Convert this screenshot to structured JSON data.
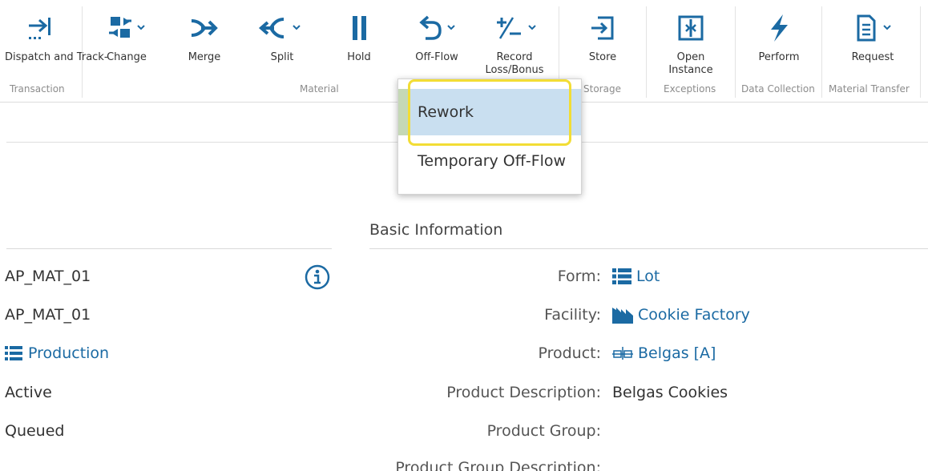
{
  "ribbon": {
    "buttons": [
      {
        "id": "dispatch",
        "label": "Dispatch and Track-",
        "icon": "dispatch-arrow-icon",
        "dropdown": false
      },
      {
        "id": "change",
        "label": "Change",
        "icon": "change-swap-icon",
        "dropdown": true
      },
      {
        "id": "merge",
        "label": "Merge",
        "icon": "merge-icon",
        "dropdown": false
      },
      {
        "id": "split",
        "label": "Split",
        "icon": "split-icon",
        "dropdown": true
      },
      {
        "id": "hold",
        "label": "Hold",
        "icon": "pause-icon",
        "dropdown": false
      },
      {
        "id": "offflow",
        "label": "Off-Flow",
        "icon": "undo-arrow-icon",
        "dropdown": true
      },
      {
        "id": "record",
        "label": "Record Loss/Bonus",
        "icon": "plus-minus-icon",
        "dropdown": true
      },
      {
        "id": "store",
        "label": "Store",
        "icon": "store-enter-icon",
        "dropdown": false
      },
      {
        "id": "open_instance",
        "label": "Open Instance",
        "icon": "open-instance-icon",
        "dropdown": false
      },
      {
        "id": "perform",
        "label": "Perform",
        "icon": "lightning-icon",
        "dropdown": false
      },
      {
        "id": "request",
        "label": "Request",
        "icon": "document-icon",
        "dropdown": true
      }
    ],
    "groups": {
      "transaction": "Transaction",
      "material": "Material",
      "storage": "Storage",
      "exceptions": "Exceptions",
      "data_collection": "Data Collection",
      "material_transfer": "Material Transfer"
    }
  },
  "dropdown": {
    "items": [
      "Rework",
      "Temporary Off-Flow"
    ]
  },
  "left_values": {
    "name": "AP_MAT_01",
    "name2": "AP_MAT_01",
    "type": "Production",
    "status": "Active",
    "state": "Queued"
  },
  "basic_info": {
    "title": "Basic Information",
    "form_label": "Form:",
    "form_value": "Lot",
    "facility_label": "Facility:",
    "facility_value": "Cookie Factory",
    "product_label": "Product:",
    "product_value": "Belgas [A]",
    "product_desc_label": "Product Description:",
    "product_desc_value": "Belgas Cookies",
    "product_group_label": "Product Group:",
    "product_group_desc_label": "Product Group Description:"
  },
  "colors": {
    "accent": "#1b6aa3",
    "highlight": "#f2dd35",
    "selected_row": "#c9dff0"
  }
}
